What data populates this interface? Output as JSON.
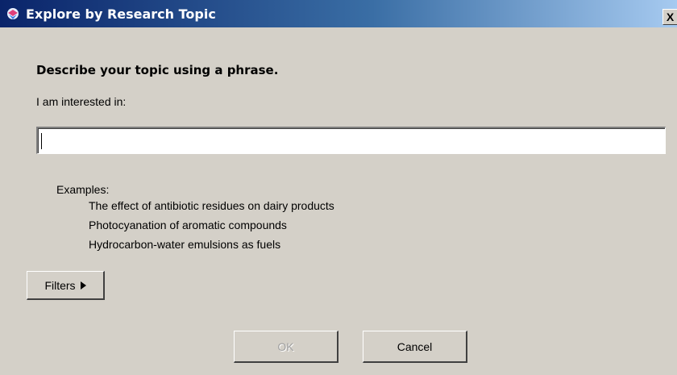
{
  "window": {
    "title": "Explore by Research Topic",
    "close_glyph": "X"
  },
  "main": {
    "heading": "Describe your topic using a phrase.",
    "prompt_label": "I am interested in:",
    "topic_input": {
      "value": "",
      "placeholder": ""
    },
    "examples_title": "Examples:",
    "examples": [
      "The effect of antibiotic residues on dairy products",
      "Photocyanation of aromatic compounds",
      "Hydrocarbon-water emulsions as fuels"
    ]
  },
  "buttons": {
    "filters_label": "Filters",
    "ok_label": "OK",
    "ok_enabled": false,
    "cancel_label": "Cancel"
  },
  "colors": {
    "dialog_bg": "#d4d0c8",
    "titlebar_start": "#0a246a",
    "titlebar_end": "#a6caf0",
    "disabled_text": "#a0a0a0"
  }
}
